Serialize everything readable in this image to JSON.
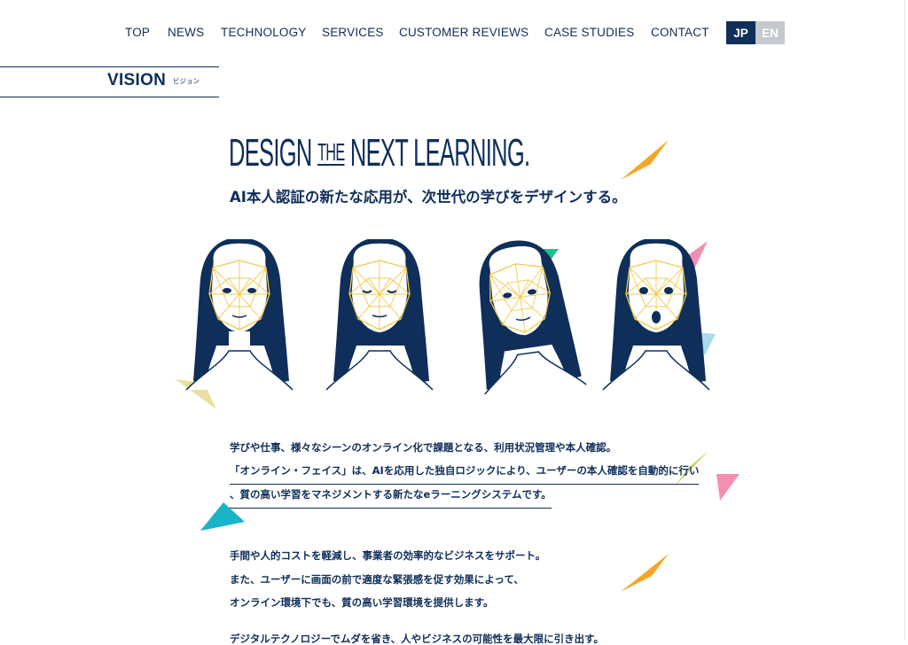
{
  "nav": {
    "items": [
      "TOP",
      "NEWS",
      "TECHNOLOGY",
      "SERVICES",
      "CUSTOMER REVIEWS",
      "CASE STUDIES",
      "CONTACT"
    ],
    "lang": {
      "jp": "JP",
      "en": "EN",
      "active": "JP"
    }
  },
  "section": {
    "title": "VISION",
    "subtitle": "ビジョン"
  },
  "hero": {
    "headline_a": "DESIGN",
    "headline_the": "THE",
    "headline_b": "NEXT LEARNING.",
    "subhead": "AI本人認証の新たな応用が、次世代の学びをデザインする。"
  },
  "faces": {
    "count": 4,
    "expressions": [
      "neutral",
      "eyes-closed",
      "head-tilted",
      "mouth-open"
    ]
  },
  "body": {
    "p1_line1": "学びや仕事、様々なシーンのオンライン化で課題となる、利用状況管理や本人確認。",
    "p1_line2": "「オンライン・フェイス」は、AIを応用した独自ロジックにより、ユーザーの本人確認を自動的に行い",
    "p1_line3": "、質の高い学習をマネジメントする新たなeラーニングシステムです。",
    "p2_line1": "手間や人的コストを軽減し、事業者の効率的なビジネスをサポート。",
    "p2_line2": "また、ユーザーに画面の前で適度な緊張感を促す効果によって、",
    "p2_line3": "オンライン環境下でも、質の高い学習環境を提供します。",
    "p3_line1": "デジタルテクノロジーでムダを省き、人やビジネスの可能性を最大限に引き出す。"
  },
  "colors": {
    "navy": "#0f2e5a",
    "mesh": "#f2c94c",
    "orange": "#f5a623",
    "pink": "#f48fb1",
    "teal": "#19b4c8",
    "lime": "#c8d66b",
    "sand": "#e8dfa0",
    "green": "#1bbf8a"
  }
}
